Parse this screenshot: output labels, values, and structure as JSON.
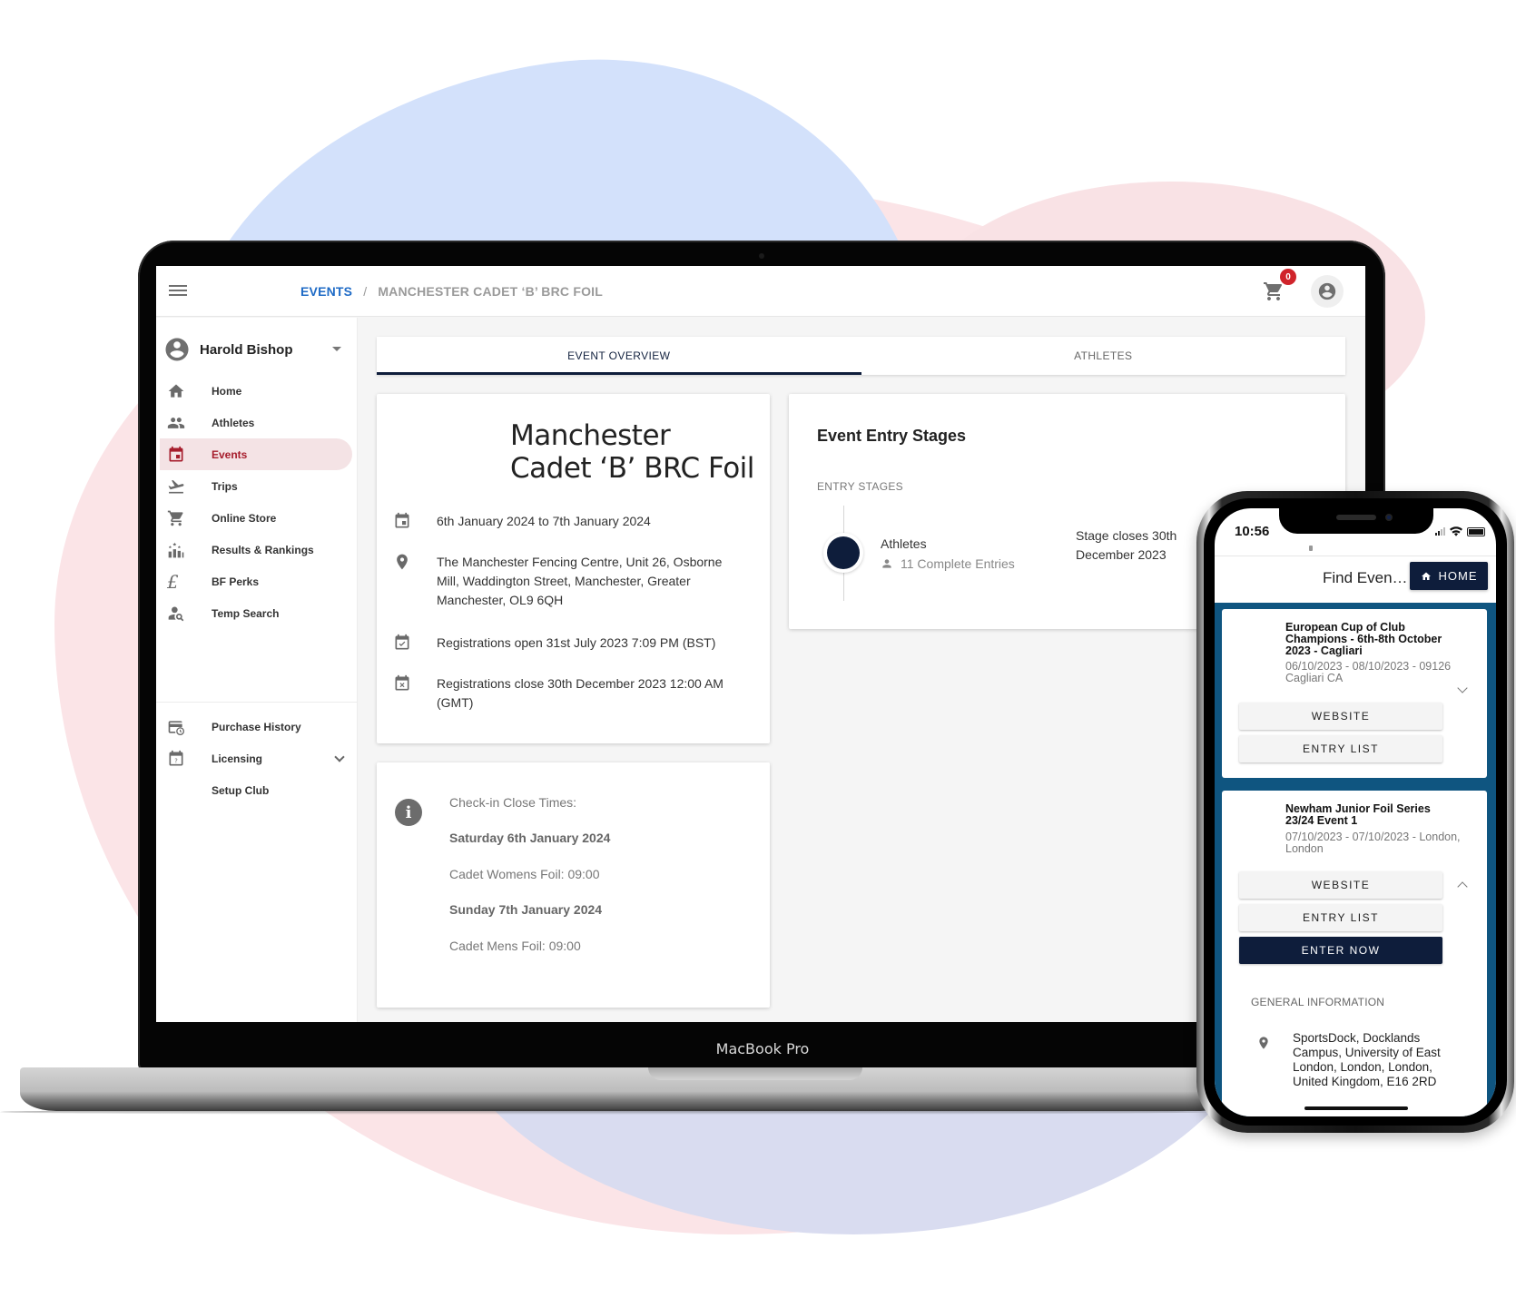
{
  "laptop": {
    "label": "MacBook Pro",
    "header": {
      "breadcrumb": {
        "parent": "EVENTS",
        "separator": "/",
        "current": "MANCHESTER CADET ‘B’ BRC FOIL"
      },
      "cart_count": "0"
    },
    "sidebar": {
      "user_name": "Harold Bishop",
      "items": [
        {
          "label": "Home",
          "icon": "home-icon"
        },
        {
          "label": "Athletes",
          "icon": "people-icon"
        },
        {
          "label": "Events",
          "icon": "calendar-icon",
          "active": true
        },
        {
          "label": "Trips",
          "icon": "flight-icon"
        },
        {
          "label": "Online Store",
          "icon": "cart-icon"
        },
        {
          "label": "Results & Rankings",
          "icon": "rankings-icon"
        },
        {
          "label": "BF Perks",
          "icon": "pound-icon"
        },
        {
          "label": "Temp Search",
          "icon": "person-search-icon"
        }
      ],
      "secondary_items": [
        {
          "label": "Purchase History",
          "icon": "purchase-history-icon"
        },
        {
          "label": "Licensing",
          "icon": "licensing-icon"
        },
        {
          "label": "Setup Club",
          "icon": ""
        }
      ]
    },
    "tabs": [
      {
        "label": "EVENT OVERVIEW",
        "active": true
      },
      {
        "label": "ATHLETES",
        "active": false
      }
    ],
    "event": {
      "title": "Manchester Cadet ‘B’ BRC Foil",
      "dates": "6th January 2024 to 7th January 2024",
      "venue": "The Manchester Fencing Centre, Unit 26, Osborne Mill, Waddington Street, Manchester, Greater Manchester, OL9 6QH",
      "registrations_open": "Registrations open 31st July 2023 7:09 PM (BST)",
      "registrations_close": "Registrations close 30th December 2023 12:00 AM (GMT)"
    },
    "checkin": {
      "heading": "Check-in Close Times:",
      "lines": [
        {
          "text": "Saturday 6th January 2024",
          "bold": true
        },
        {
          "text": "Cadet Womens Foil: 09:00",
          "bold": false
        },
        {
          "text": "Sunday 7th January 2024",
          "bold": true
        },
        {
          "text": "Cadet Mens Foil: 09:00",
          "bold": false
        }
      ]
    },
    "stages": {
      "title": "Event Entry Stages",
      "subtitle": "ENTRY STAGES",
      "stage_name": "Athletes",
      "stage_count": "11 Complete Entries",
      "stage_close": "Stage closes 30th December 2023"
    }
  },
  "phone": {
    "time": "10:56",
    "title": "Find Even…",
    "home_button": "HOME",
    "events": [
      {
        "title": "European Cup of Club Champions - 6th-8th October 2023 - Cagliari",
        "meta": "06/10/2023 - 08/10/2023 - 09126 Cagliari CA",
        "buttons": [
          "WEBSITE",
          "ENTRY LIST"
        ],
        "expanded": false
      },
      {
        "title": "Newham Junior Foil Series 23/24 Event 1",
        "meta": "07/10/2023 - 07/10/2023 - London, London",
        "buttons": [
          "WEBSITE",
          "ENTRY LIST",
          "ENTER NOW"
        ],
        "expanded": true
      }
    ],
    "general_info_label": "GENERAL INFORMATION",
    "address": "SportsDock, Docklands Campus, University of East London, London, London, United Kingdom, E16 2RD"
  },
  "colors": {
    "brand_navy": "#0e1d3b",
    "link_blue": "#1f6bc6",
    "active_red": "#a61d2c",
    "badge_red": "#d0242b",
    "phone_list_bg": "#0f5580"
  }
}
